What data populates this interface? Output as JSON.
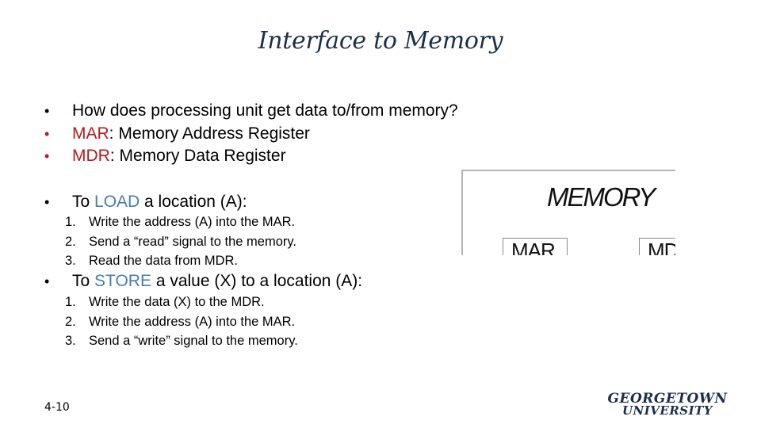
{
  "slide": {
    "title": "Interface to Memory",
    "slide_number": "4-10"
  },
  "bullets": [
    {
      "marker": "•",
      "prefix": "",
      "term": "",
      "text": "How does processing unit get data to/from memory?"
    },
    {
      "marker": "•",
      "term": "MAR",
      "text": ": Memory Address Register"
    },
    {
      "marker": "•",
      "term": "MDR",
      "text": ": Memory Data Register"
    }
  ],
  "load": {
    "marker": "•",
    "prefix": "To ",
    "term": "LOAD",
    "suffix": " a location (A):",
    "steps": [
      {
        "num": "1.",
        "text": "Write the address (A) into the MAR."
      },
      {
        "num": "2.",
        "text": "Send a “read” signal to the memory."
      },
      {
        "num": "3.",
        "text": "Read the data from MDR."
      }
    ]
  },
  "store": {
    "marker": "•",
    "prefix": "To ",
    "term": "STORE",
    "suffix": " a value (X) to a location (A):",
    "steps": [
      {
        "num": "1.",
        "text": "Write the data (X) to the MDR."
      },
      {
        "num": "2.",
        "text": "Write the address (A) into the MAR."
      },
      {
        "num": "3.",
        "text": "Send a “write” signal to the memory."
      }
    ]
  },
  "diagram": {
    "label": "MEMORY",
    "mar_box": "MAR",
    "mdr_box": "MDR"
  },
  "logo": {
    "line1": "GEORGETOWN",
    "line2": "UNIVERSITY"
  },
  "colors": {
    "title": "#1c2f4a",
    "red_term": "#b31b1b",
    "blue_term": "#4a7ea6"
  }
}
